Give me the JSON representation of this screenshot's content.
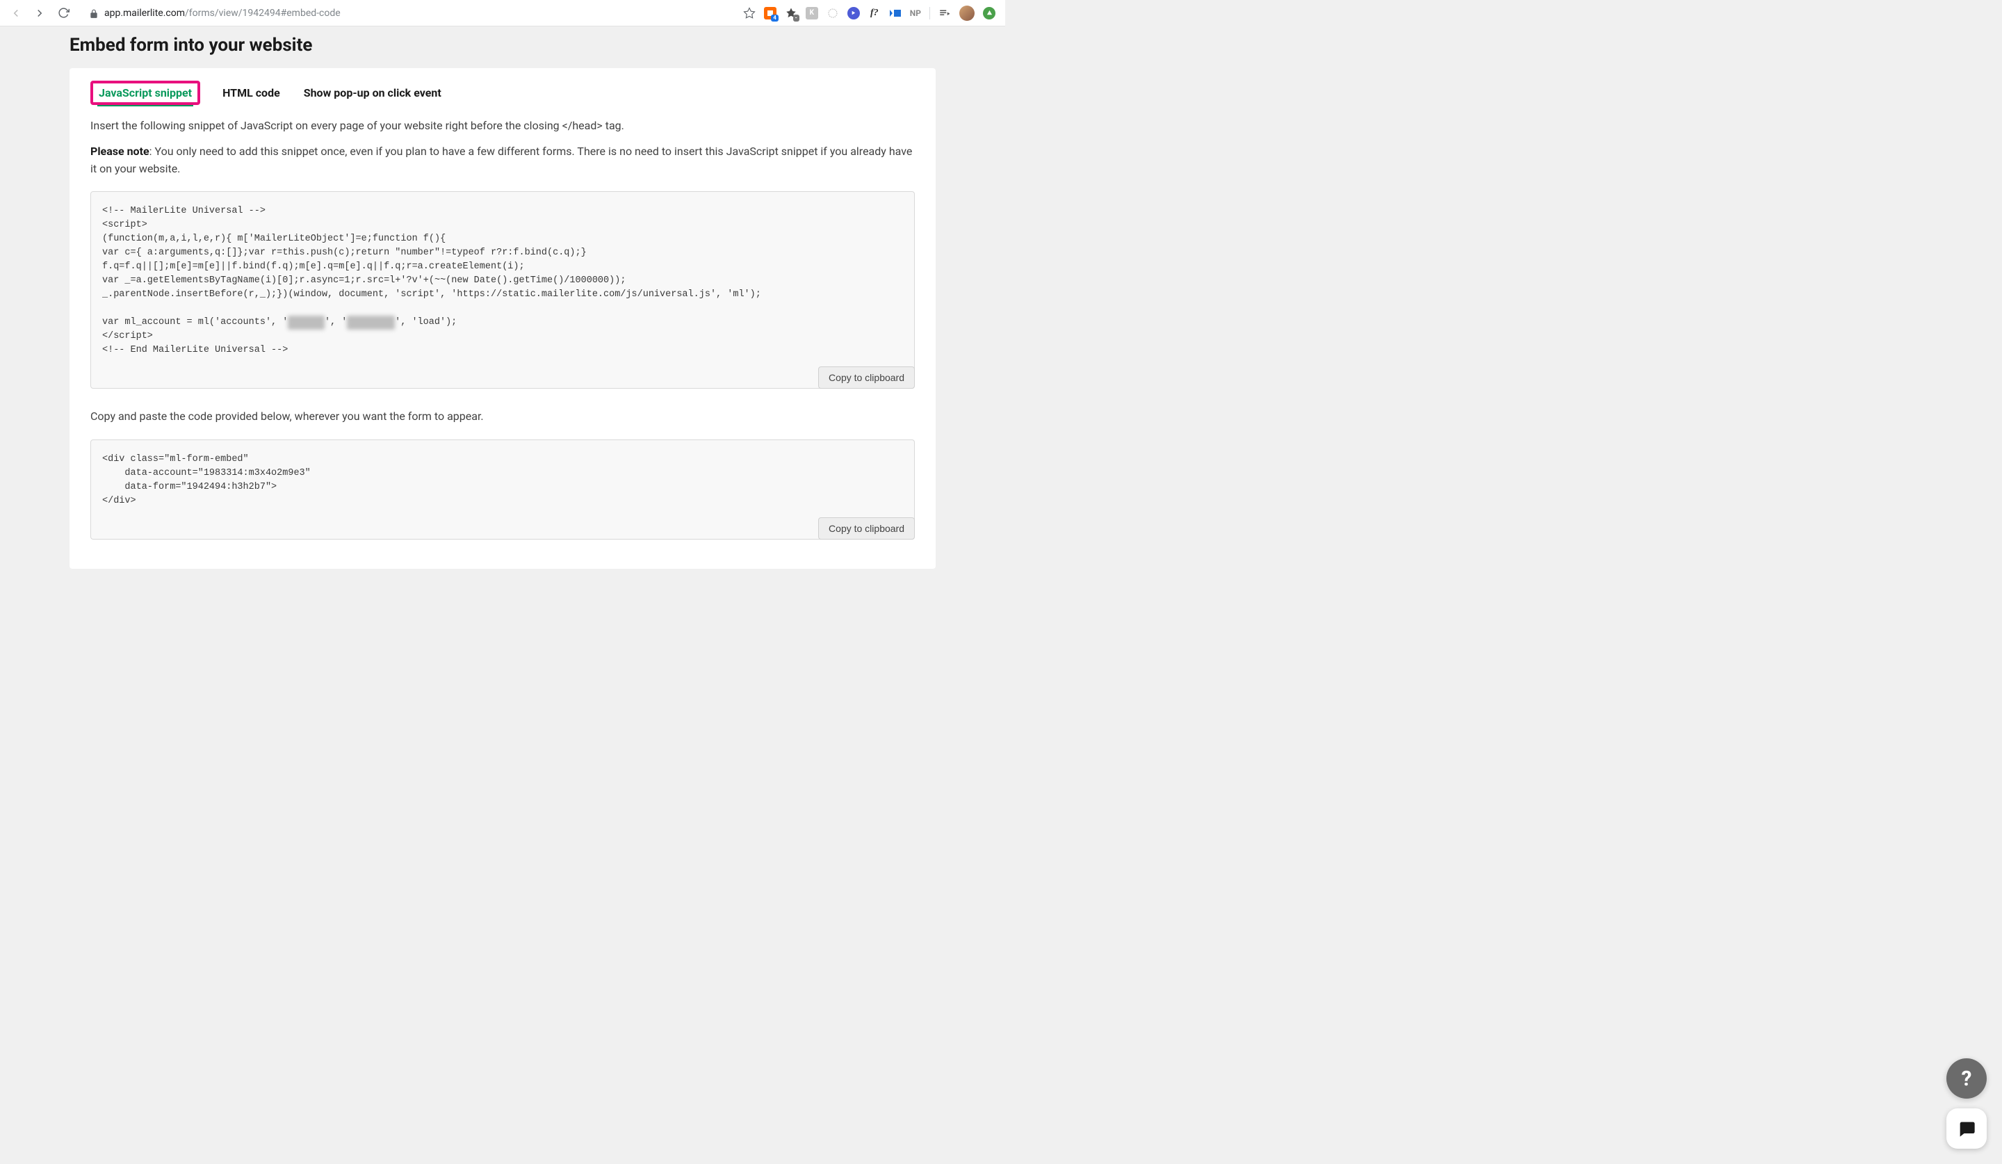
{
  "browser": {
    "url_host": "app.mailerlite.com",
    "url_path": "/forms/view/1942494#embed-code",
    "extensions": {
      "badge1": "4",
      "np_label": "NP"
    }
  },
  "page": {
    "title": "Embed form into your website"
  },
  "tabs": [
    {
      "label": "JavaScript snippet",
      "active": true,
      "highlighted": true
    },
    {
      "label": "HTML code",
      "active": false
    },
    {
      "label": "Show pop-up on click event",
      "active": false
    }
  ],
  "intro": {
    "line1": "Insert the following snippet of JavaScript on every page of your website right before the closing </head> tag.",
    "note_label": "Please note",
    "note_text": ": You only need to add this snippet once, even if you plan to have a few different forms. There is no need to insert this JavaScript snippet if you already have it on your website."
  },
  "code1": {
    "l1": "<!-- MailerLite Universal -->",
    "l2": "<script>",
    "l3": "(function(m,a,i,l,e,r){ m['MailerLiteObject']=e;function f(){",
    "l4": "var c={ a:arguments,q:[]};var r=this.push(c);return \"number\"!=typeof r?r:f.bind(c.q);}",
    "l5": "f.q=f.q||[];m[e]=m[e]||f.bind(f.q);m[e].q=m[e].q||f.q;r=a.createElement(i);",
    "l6": "var _=a.getElementsByTagName(i)[0];r.async=1;r.src=l+'?v'+(~~(new Date().getTime()/1000000));",
    "l7": "_.parentNode.insertBefore(r,_);})(window, document, 'script', 'https://static.mailerlite.com/js/universal.js', 'ml');",
    "l8": "",
    "l9a": "var ml_account = ml('accounts', '",
    "l9r1": "XXX  X",
    "l9b": "', '",
    "l9r2": "XXX XXXX",
    "l9c": "', 'load');",
    "l10": "</script>",
    "l11": "<!-- End MailerLite Universal -->"
  },
  "mid_para": "Copy and paste the code provided below, wherever you want the form to appear.",
  "code2": {
    "l1": "<div class=\"ml-form-embed\"",
    "l2": "    data-account=\"1983314:m3x4o2m9e3\"",
    "l3": "    data-form=\"1942494:h3h2b7\">",
    "l4": "</div>"
  },
  "buttons": {
    "copy": "Copy to clipboard"
  },
  "fab": {
    "help": "?"
  }
}
